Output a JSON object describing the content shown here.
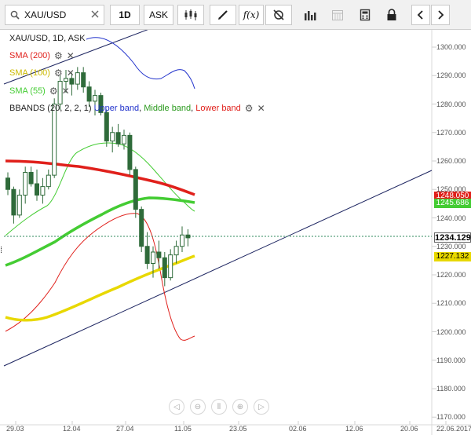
{
  "toolbar": {
    "symbol": "XAU/USD",
    "interval": "1D",
    "price_type": "ASK",
    "fx_label": "f(x)"
  },
  "chart": {
    "header": "XAU/USD, 1D, ASK",
    "indicators": [
      {
        "label": "SMA (200)",
        "color": "#e0201b"
      },
      {
        "label": "SMA (100)",
        "color": "#e8d800"
      },
      {
        "label": "SMA (55)",
        "color": "#44cc33"
      }
    ],
    "bbands": {
      "prefix": "BBANDS (20, 2, 2, 1)",
      "upper": "Upper band",
      "middle": "Middle band",
      "lower": "Lower band",
      "sep": ","
    },
    "price_tags": [
      {
        "value": "1248.050",
        "bg": "#e0201b",
        "fg": "#ffffff"
      },
      {
        "value": "1245.686",
        "bg": "#44cc33",
        "fg": "#ffffff"
      },
      {
        "value": "1234.129",
        "bg": "#ffffff",
        "fg": "#000000"
      },
      {
        "value": "1227.132",
        "bg": "#e8d800",
        "fg": "#000000"
      }
    ],
    "y_ticks": [
      "1300.000",
      "1290.000",
      "1280.000",
      "1270.000",
      "1260.000",
      "1250.000",
      "1240.000",
      "1230.000",
      "1220.000",
      "1210.000",
      "1200.000",
      "1190.000",
      "1180.000",
      "1170.000"
    ],
    "x_ticks": [
      "29.03",
      "12.04",
      "27.04",
      "11.05",
      "23.05",
      "02.06",
      "12.06",
      "20.06",
      "22.06.2017"
    ]
  },
  "chart_data": {
    "type": "candlestick",
    "title": "XAU/USD, 1D, ASK",
    "ylim": [
      1170,
      1305
    ],
    "candles": [
      [
        1254,
        1256,
        1248,
        1250
      ],
      [
        1250,
        1251,
        1238,
        1241
      ],
      [
        1241,
        1250,
        1240,
        1248
      ],
      [
        1248,
        1258,
        1245,
        1256
      ],
      [
        1256,
        1258,
        1251,
        1252
      ],
      [
        1252,
        1257,
        1246,
        1248
      ],
      [
        1248,
        1254,
        1245,
        1251
      ],
      [
        1251,
        1257,
        1250,
        1255
      ],
      [
        1255,
        1282,
        1254,
        1280
      ],
      [
        1280,
        1290,
        1278,
        1288
      ],
      [
        1288,
        1292,
        1284,
        1289
      ],
      [
        1289,
        1291,
        1283,
        1287
      ],
      [
        1287,
        1293,
        1285,
        1291
      ],
      [
        1291,
        1293,
        1284,
        1286
      ],
      [
        1286,
        1288,
        1279,
        1281
      ],
      [
        1281,
        1285,
        1276,
        1283
      ],
      [
        1283,
        1284,
        1276,
        1277
      ],
      [
        1277,
        1278,
        1265,
        1267
      ],
      [
        1267,
        1272,
        1263,
        1270
      ],
      [
        1270,
        1273,
        1265,
        1266
      ],
      [
        1266,
        1271,
        1264,
        1269
      ],
      [
        1269,
        1270,
        1255,
        1257
      ],
      [
        1257,
        1258,
        1240,
        1243
      ],
      [
        1243,
        1244,
        1228,
        1230
      ],
      [
        1230,
        1235,
        1222,
        1224
      ],
      [
        1224,
        1230,
        1219,
        1228
      ],
      [
        1228,
        1232,
        1222,
        1226
      ],
      [
        1226,
        1228,
        1216,
        1219
      ],
      [
        1219,
        1229,
        1218,
        1227
      ],
      [
        1227,
        1232,
        1224,
        1230
      ],
      [
        1230,
        1237,
        1228,
        1234
      ],
      [
        1234,
        1236,
        1230,
        1233
      ]
    ],
    "series": [
      {
        "name": "SMA (200)",
        "values": [
          1260,
          1258.5,
          1256.8,
          1255,
          1252.5,
          1250,
          1248
        ]
      },
      {
        "name": "SMA (100)",
        "values": [
          1205,
          1205,
          1207,
          1212,
          1217,
          1222,
          1226,
          1227
        ]
      },
      {
        "name": "SMA (55)",
        "values": [
          1227,
          1233,
          1240,
          1244,
          1247,
          1247,
          1246
        ]
      }
    ]
  }
}
